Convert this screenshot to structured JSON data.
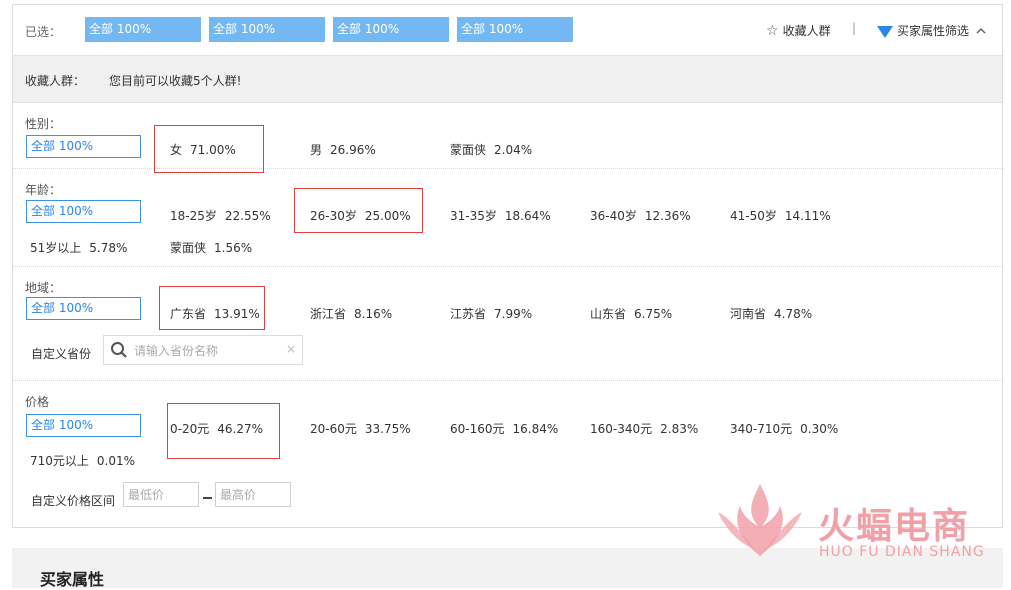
{
  "selected": {
    "label": "已选：",
    "tags": [
      "全部 100%",
      "全部 100%",
      "全部 100%",
      "全部 100%"
    ],
    "favorite_label": "收藏人群",
    "separator": "|",
    "filter_label": "买家属性筛选",
    "icons": {
      "favorite": "star-icon",
      "filter": "funnel-icon",
      "toggle": "chevron-up-icon"
    }
  },
  "favorites": {
    "label": "收藏人群：",
    "message": "您目前可以收藏5个人群!"
  },
  "gender": {
    "title": "性别：",
    "all": "全部 100%",
    "options": [
      {
        "name": "女",
        "pct": "71.00%"
      },
      {
        "name": "男",
        "pct": "26.96%"
      },
      {
        "name": "蒙面侠",
        "pct": "2.04%"
      }
    ]
  },
  "age": {
    "title": "年龄：",
    "all": "全部 100%",
    "options": [
      {
        "name": "18-25岁",
        "pct": "22.55%"
      },
      {
        "name": "26-30岁",
        "pct": "25.00%"
      },
      {
        "name": "31-35岁",
        "pct": "18.64%"
      },
      {
        "name": "36-40岁",
        "pct": "12.36%"
      },
      {
        "name": "41-50岁",
        "pct": "14.11%"
      },
      {
        "name": "51岁以上",
        "pct": "5.78%"
      },
      {
        "name": "蒙面侠",
        "pct": "1.56%"
      }
    ]
  },
  "region": {
    "title": "地域：",
    "all": "全部 100%",
    "options": [
      {
        "name": "广东省",
        "pct": "13.91%"
      },
      {
        "name": "浙江省",
        "pct": "8.16%"
      },
      {
        "name": "江苏省",
        "pct": "7.99%"
      },
      {
        "name": "山东省",
        "pct": "6.75%"
      },
      {
        "name": "河南省",
        "pct": "4.78%"
      }
    ],
    "custom_label": "自定义省份",
    "search_placeholder": "请输入省份名称",
    "clear": "×"
  },
  "price": {
    "title": "价格",
    "all": "全部 100%",
    "options": [
      {
        "name": "0-20元",
        "pct": "46.27%"
      },
      {
        "name": "20-60元",
        "pct": "33.75%"
      },
      {
        "name": "60-160元",
        "pct": "16.84%"
      },
      {
        "name": "160-340元",
        "pct": "2.83%"
      },
      {
        "name": "340-710元",
        "pct": "0.30%"
      },
      {
        "name": "710元以上",
        "pct": "0.01%"
      }
    ],
    "custom_label": "自定义价格区间",
    "min_placeholder": "最低价",
    "max_placeholder": "最高价"
  },
  "bottom": {
    "title": "买家属性"
  },
  "watermark": {
    "text": "火蝠电商",
    "sub": "HUO FU DIAN SHANG"
  },
  "colors": {
    "tag_bg": "#73b8f2",
    "accent": "#2a86e8",
    "highlight": "#e0403a",
    "watermark": "#f2a0a8"
  }
}
